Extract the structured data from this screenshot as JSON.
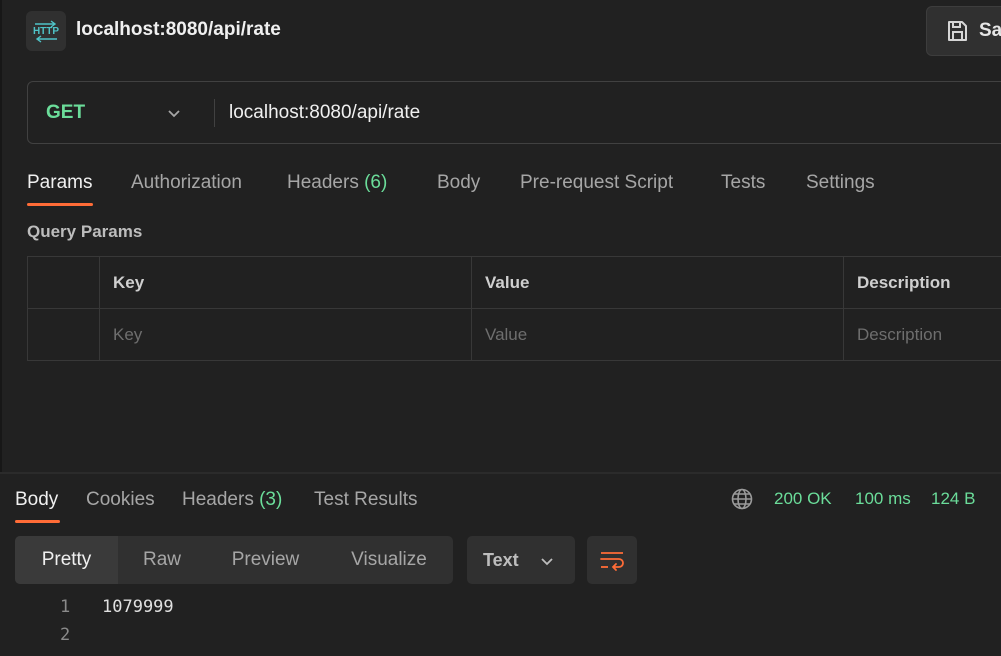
{
  "request": {
    "badge_text": "HTTP",
    "title": "localhost:8080/api/rate",
    "save_label": "Sa",
    "method": "GET",
    "url": "localhost:8080/api/rate"
  },
  "request_tabs": [
    {
      "label": "Params",
      "active": true
    },
    {
      "label": "Authorization"
    },
    {
      "label": "Headers",
      "count": "(6)"
    },
    {
      "label": "Body"
    },
    {
      "label": "Pre-request Script"
    },
    {
      "label": "Tests"
    },
    {
      "label": "Settings"
    }
  ],
  "query_params": {
    "label": "Query Params",
    "headers": [
      "Key",
      "Value",
      "Description"
    ],
    "placeholders": [
      "Key",
      "Value",
      "Description"
    ]
  },
  "response_tabs": [
    {
      "label": "Body",
      "active": true
    },
    {
      "label": "Cookies"
    },
    {
      "label": "Headers",
      "count": "(3)"
    },
    {
      "label": "Test Results"
    }
  ],
  "status": {
    "code": "200 OK",
    "time": "100 ms",
    "size": "124 B"
  },
  "view_modes": [
    "Pretty",
    "Raw",
    "Preview",
    "Visualize"
  ],
  "format": "Text",
  "code_lines": [
    {
      "n": "1",
      "text": "1079999"
    },
    {
      "n": "2",
      "text": ""
    }
  ],
  "colors": {
    "accent": "#ff6c37",
    "success": "#6bdd9a",
    "background": "#212121"
  }
}
